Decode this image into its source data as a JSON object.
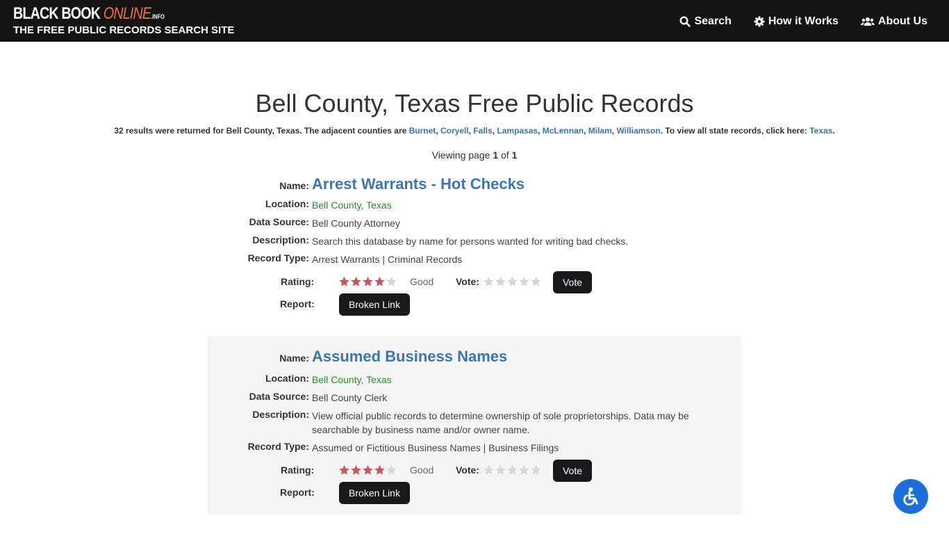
{
  "header": {
    "logo": {
      "part1": "BLACK BOOK ",
      "part2": "ONLINE",
      "part3": ".INFO",
      "tagline": "THE FREE PUBLIC RECORDS SEARCH SITE"
    },
    "nav": [
      {
        "label": "Search",
        "icon": "search-icon"
      },
      {
        "label": "How it Works",
        "icon": "gear-icon"
      },
      {
        "label": "About Us",
        "icon": "users-icon"
      }
    ]
  },
  "page": {
    "title": "Bell County, Texas Free Public Records",
    "summary_prefix": "32 results were returned for Bell County, Texas. The adjacent counties are ",
    "adjacent_counties": [
      "Burnet",
      "Coryell",
      "Falls",
      "Lampasas",
      "McLennan",
      "Milam",
      "Williamson"
    ],
    "summary_mid": ". To view all state records, click here: ",
    "state_link": "Texas",
    "summary_end": ".",
    "pager": {
      "prefix": "Viewing page ",
      "current": "1",
      "sep": " of ",
      "total": "1"
    }
  },
  "labels": {
    "name": "Name:",
    "location": "Location:",
    "data_source": "Data Source:",
    "description": "Description:",
    "record_type": "Record Type:",
    "rating": "Rating:",
    "vote": "Vote:",
    "report": "Report:",
    "vote_button": "Vote",
    "broken_link_button": "Broken Link"
  },
  "colors": {
    "star_filled": "#c9565a",
    "star_empty": "#d6d6d6",
    "link": "#3a76b3",
    "location": "#2e8b2e",
    "accessibility": "#1a6fdb"
  },
  "records": [
    {
      "name": "Arrest Warrants - Hot Checks",
      "location": "Bell County, Texas",
      "data_source": "Bell County Attorney",
      "description": "Search this database by name for persons wanted for writing bad checks.",
      "record_type": "Arrest Warrants | Criminal Records",
      "rating": 4,
      "rating_max": 5,
      "rating_word": "Good",
      "vote": 0
    },
    {
      "name": "Assumed Business Names",
      "location": "Bell County, Texas",
      "data_source": "Bell County Clerk",
      "description": "View official public records to determine ownership of sole proprietorships. Data may be searchable by business name and/or owner name.",
      "record_type": "Assumed or Fictitious Business Names | Business Filings",
      "rating": 4,
      "rating_max": 5,
      "rating_word": "Good",
      "vote": 0
    }
  ]
}
